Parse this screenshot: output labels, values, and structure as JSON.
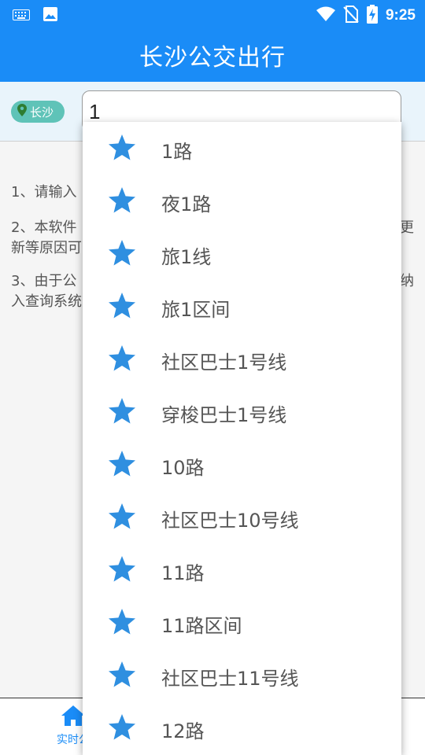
{
  "status_bar": {
    "time": "9:25",
    "icons": [
      "keyboard-icon",
      "image-icon",
      "wifi-icon",
      "no-sim-icon",
      "battery-charging-icon"
    ]
  },
  "app": {
    "title": "长沙公交出行"
  },
  "search": {
    "city": "长沙",
    "value": "1",
    "city_icon": "location-pin-icon"
  },
  "notes": [
    {
      "line1": "1、请输入",
      "line2": ""
    },
    {
      "line1": "2、本软件",
      "line1_tail": "更",
      "line2": "新等原因可"
    },
    {
      "line1": "3、由于公",
      "line1_tail": "纳",
      "line2": "入查询系统"
    }
  ],
  "bottom_nav": {
    "tab_label": "实时公",
    "tab_icon": "home-icon"
  },
  "suggestions": [
    "1路",
    "夜1路",
    "旅1线",
    "旅1区间",
    "社区巴士1号线",
    "穿梭巴士1号线",
    "10路",
    "社区巴士10号线",
    "11路",
    "11路区间",
    "社区巴士11号线",
    "12路"
  ],
  "colors": {
    "primary": "#1a8cf7",
    "chip": "#5fc3b8",
    "star": "#2f8fe0"
  }
}
